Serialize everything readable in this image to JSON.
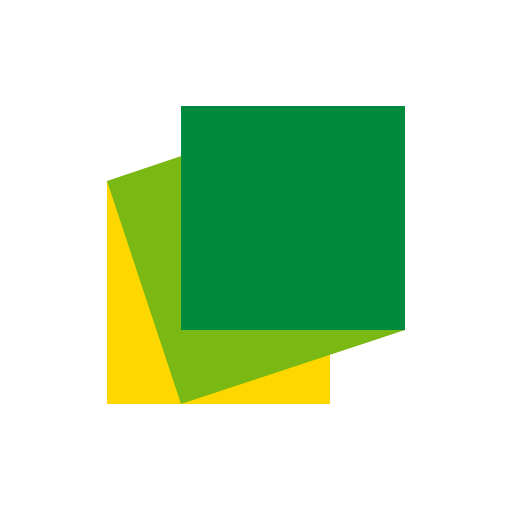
{
  "icon": {
    "name": "stacked-squares-icon",
    "background": "#ffffff",
    "colors": {
      "back_square": "#FFD700",
      "middle_square": "#7AB814",
      "front_square": "#008A3E"
    }
  }
}
